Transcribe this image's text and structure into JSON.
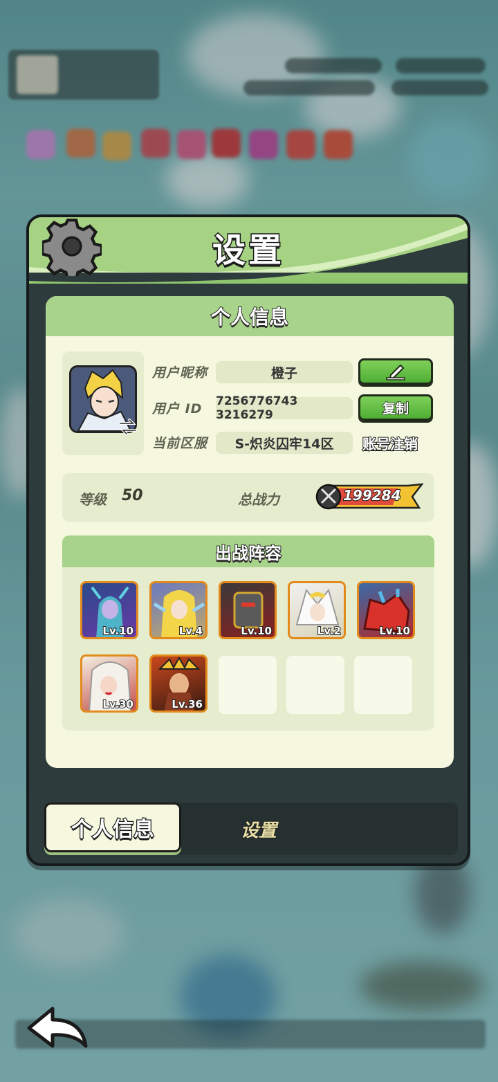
{
  "dialog": {
    "title": "设置",
    "panel_header": "个人信息"
  },
  "profile": {
    "nickname_label": "用户昵称",
    "nickname_value": "橙子",
    "id_label": "用户 ID",
    "id_value": "7256776743​3216279",
    "server_label": "当前区服",
    "server_value": "S-炽炎囚牢14区",
    "copy_label": "复制",
    "cancel_account_label": "账号注销"
  },
  "stats": {
    "level_label": "等级",
    "level_value": "50",
    "power_label": "总战力",
    "power_value": "199284"
  },
  "lineup": {
    "title": "出战阵容",
    "heroes": [
      {
        "level": "Lv.10"
      },
      {
        "level": "Lv.4"
      },
      {
        "level": "Lv.10"
      },
      {
        "level": "Lv.2"
      },
      {
        "level": "Lv.10"
      },
      {
        "level": "Lv.30"
      },
      {
        "level": "Lv.36"
      }
    ],
    "empty_slots": 3
  },
  "tabs": {
    "profile_tab": "个人信息",
    "settings_tab": "设置"
  },
  "icons": {
    "gear": "gear-icon",
    "edit": "pencil-icon",
    "swap": "swap-icon",
    "power": "crossed-swords-icon",
    "back": "back-arrow-icon"
  },
  "colors": {
    "header_green": "#a8d38a",
    "button_green": "#5cbf3d",
    "panel_bg": "#f5f8df",
    "hero_border": "#e38a1c"
  }
}
